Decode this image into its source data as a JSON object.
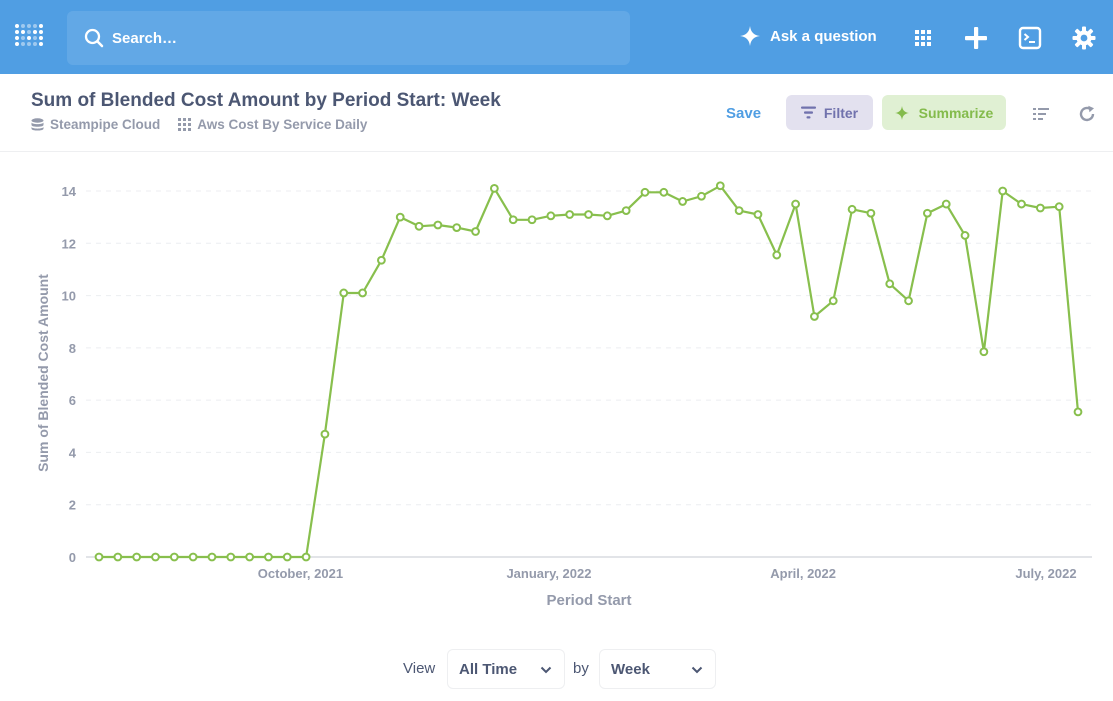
{
  "navbar": {
    "search_placeholder": "Search…",
    "ask_label": "Ask a question"
  },
  "header": {
    "title": "Sum of Blended Cost Amount by Period Start: Week",
    "breadcrumbs": [
      {
        "label": "Steampipe Cloud",
        "icon": "database-icon"
      },
      {
        "label": "Aws Cost By Service Daily",
        "icon": "table-grid-icon"
      }
    ],
    "save_label": "Save",
    "filter_label": "Filter",
    "summarize_label": "Summarize"
  },
  "footer": {
    "view_label": "View",
    "view_value": "All Time",
    "by_label": "by",
    "by_value": "Week"
  },
  "colors": {
    "brand": "#509ee3",
    "series": "#88bf4d",
    "filter_bg": "#e3e1ef",
    "filter_text": "#7172ad",
    "summarize_bg": "#e0f0d3",
    "summarize_text": "#84bb4c"
  },
  "chart_data": {
    "type": "line",
    "xlabel": "Period Start",
    "ylabel": "Sum of Blended Cost Amount",
    "ylim": [
      0,
      14
    ],
    "y_ticks": [
      0,
      2,
      4,
      6,
      8,
      10,
      12,
      14
    ],
    "x_tick_labels": [
      "October, 2021",
      "January, 2022",
      "April, 2022",
      "July, 2022"
    ],
    "grid": "horizontal dashed",
    "series": [
      {
        "values": [
          0,
          0,
          0,
          0,
          0,
          0,
          0,
          0,
          0,
          0,
          0,
          0,
          4.7,
          10.1,
          10.1,
          11.35,
          13.0,
          12.65,
          12.7,
          12.6,
          12.45,
          14.1,
          12.9,
          12.9,
          13.05,
          13.1,
          13.1,
          13.05,
          13.25,
          13.95,
          13.95,
          13.6,
          13.8,
          14.2,
          13.25,
          13.1,
          11.55,
          13.5,
          9.2,
          9.8,
          13.3,
          13.15,
          10.45,
          9.8,
          13.15,
          13.5,
          12.3,
          7.85,
          14.0,
          13.5,
          13.35,
          13.4,
          5.55
        ]
      }
    ]
  }
}
